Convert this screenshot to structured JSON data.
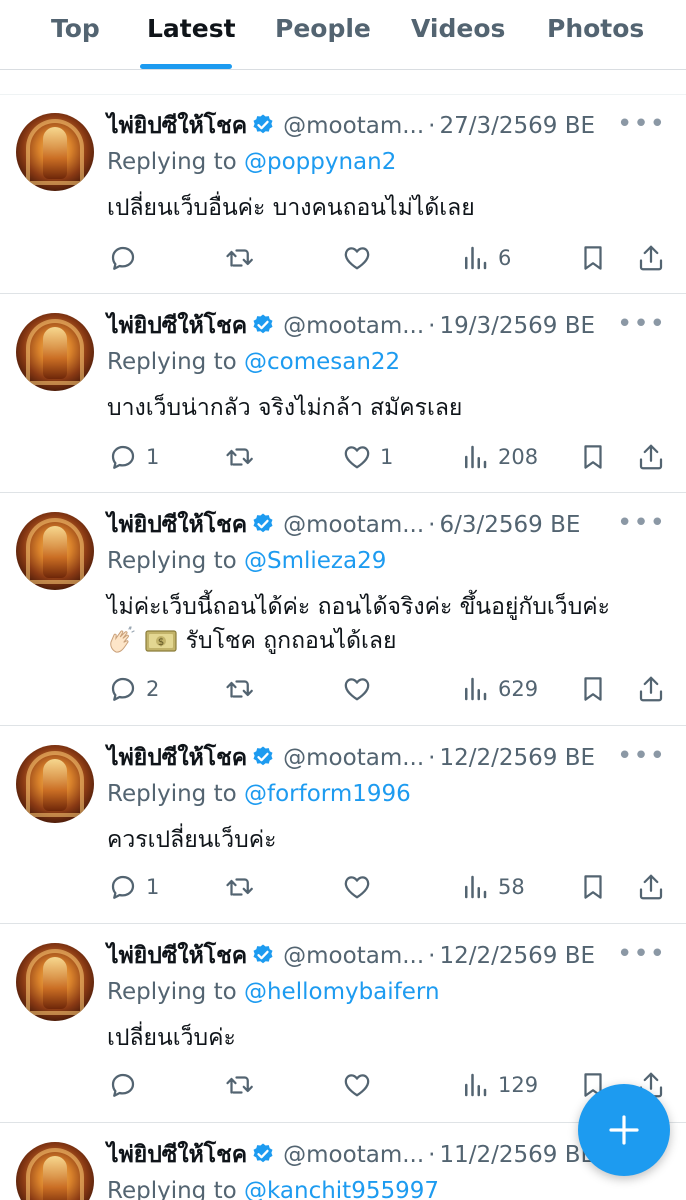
{
  "tabs": [
    {
      "label": "Top",
      "active": false
    },
    {
      "label": "Latest",
      "active": true
    },
    {
      "label": "People",
      "active": false
    },
    {
      "label": "Videos",
      "active": false
    },
    {
      "label": "Photos",
      "active": false
    }
  ],
  "tweets": [
    {
      "name": "ไพ่ยิปซีให้โชค",
      "handle": "@mootam...",
      "date": "27/3/2569 BE",
      "reply_prefix": "Replying to",
      "reply_to": "@poppynan2",
      "text": "เปลี่ยนเว็บอื่นค่ะ บางคนถอนไม่ได้เลย",
      "text2": "",
      "replies": "",
      "retweets": "",
      "likes": "",
      "views": "6"
    },
    {
      "name": "ไพ่ยิปซีให้โชค",
      "handle": "@mootam...",
      "date": "19/3/2569 BE",
      "reply_prefix": "Replying to",
      "reply_to": "@comesan22",
      "text": "บางเว็บน่ากลัว จริงไม่กล้า สมัครเลย",
      "text2": "",
      "replies": "1",
      "retweets": "",
      "likes": "1",
      "views": "208"
    },
    {
      "name": "ไพ่ยิปซีให้โชค",
      "handle": "@mootam...",
      "date": "6/3/2569 BE",
      "reply_prefix": "Replying to",
      "reply_to": "@Smlieza29",
      "text": "ไม่ค่ะเว็บนี้ถอนได้ค่ะ ถอนได้จริงค่ะ ขึ้นอยู่กับเว็บค่ะ",
      "text2": "รับโชค ถูกถอนได้เลย",
      "replies": "2",
      "retweets": "",
      "likes": "",
      "views": "629"
    },
    {
      "name": "ไพ่ยิปซีให้โชค",
      "handle": "@mootam...",
      "date": "12/2/2569 BE",
      "reply_prefix": "Replying to",
      "reply_to": "@forform1996",
      "text": "ควรเปลี่ยนเว็บค่ะ",
      "text2": "",
      "replies": "1",
      "retweets": "",
      "likes": "",
      "views": "58"
    },
    {
      "name": "ไพ่ยิปซีให้โชค",
      "handle": "@mootam...",
      "date": "12/2/2569 BE",
      "reply_prefix": "Replying to",
      "reply_to": "@hellomybaifern",
      "text": "เปลี่ยนเว็บค่ะ",
      "text2": "",
      "replies": "",
      "retweets": "",
      "likes": "",
      "views": "129"
    },
    {
      "name": "ไพ่ยิปซีให้โชค",
      "handle": "@mootam...",
      "date": "11/2/2569 BE",
      "reply_prefix": "Replying to",
      "reply_to": "@kanchit955997",
      "text": "",
      "text2": "",
      "replies": "",
      "retweets": "",
      "likes": "",
      "views": ""
    }
  ],
  "colors": {
    "accent": "#1d9bf0",
    "secondary_text": "#536471",
    "primary_text": "#0f1419"
  },
  "icons": [
    "reply-icon",
    "retweet-icon",
    "like-icon",
    "views-icon",
    "bookmark-icon",
    "share-icon",
    "verified-icon",
    "more-icon",
    "compose-plus-icon"
  ]
}
